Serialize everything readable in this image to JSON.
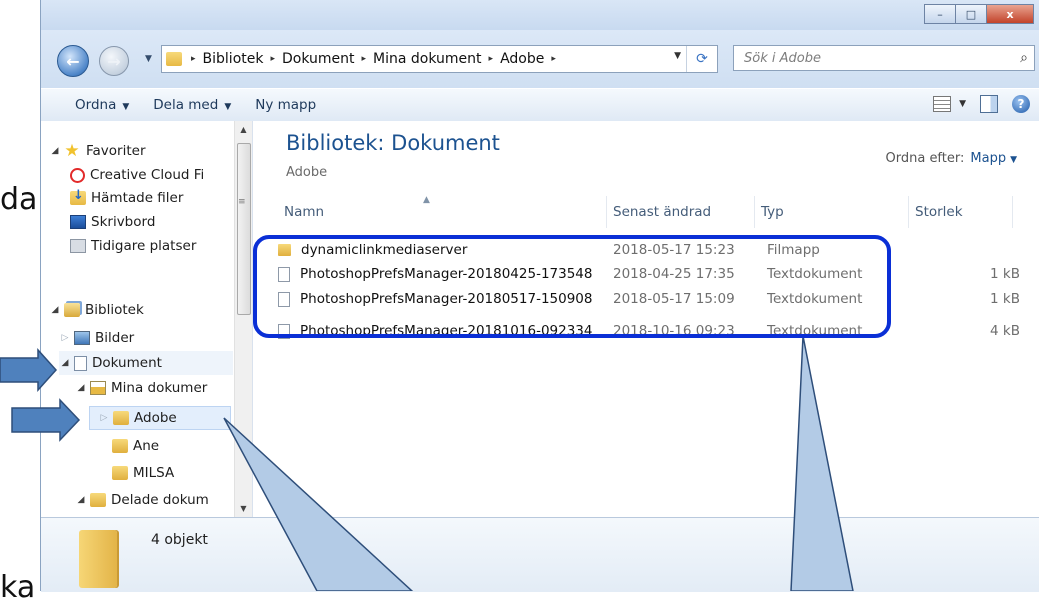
{
  "side_text": {
    "left_top": "da",
    "left_bottom": "ka"
  },
  "window": {
    "controls": {
      "minimize": "–",
      "maximize": "□",
      "close": "x"
    }
  },
  "address_bar": {
    "breadcrumbs": [
      "Bibliotek",
      "Dokument",
      "Mina dokument",
      "Adobe"
    ],
    "separator": "▸"
  },
  "search": {
    "placeholder": "Sök i Adobe"
  },
  "toolbar": {
    "organize": "Ordna",
    "share": "Dela med",
    "new_folder": "Ny mapp"
  },
  "nav_pane": {
    "items": [
      {
        "label": "Favoriter",
        "icon": "star-icon"
      },
      {
        "label": "Creative Cloud Fi",
        "icon": "creative-cloud-icon"
      },
      {
        "label": "Hämtade filer",
        "icon": "downloads-icon"
      },
      {
        "label": "Skrivbord",
        "icon": "desktop-icon"
      },
      {
        "label": "Tidigare platser",
        "icon": "recent-places-icon"
      },
      {
        "label": "Bibliotek",
        "icon": "libraries-icon"
      },
      {
        "label": "Bilder",
        "icon": "pictures-icon"
      },
      {
        "label": "Dokument",
        "icon": "documents-icon"
      },
      {
        "label": "Mina dokumer",
        "icon": "my-documents-icon"
      },
      {
        "label": "Adobe",
        "icon": "folder-icon"
      },
      {
        "label": "Ane",
        "icon": "folder-icon"
      },
      {
        "label": "MILSA",
        "icon": "folder-icon"
      },
      {
        "label": "Delade dokum",
        "icon": "folder-icon"
      }
    ]
  },
  "content": {
    "library_title": "Bibliotek: Dokument",
    "library_subtitle": "Adobe",
    "arrange_label": "Ordna efter:",
    "arrange_value": "Mapp",
    "columns": {
      "name": "Namn",
      "modified": "Senast ändrad",
      "type": "Typ",
      "size": "Storlek"
    },
    "files": [
      {
        "name": "dynamiclinkmediaserver",
        "modified": "2018-05-17 15:23",
        "type": "Filmapp",
        "size": "",
        "icon": "folder-icon"
      },
      {
        "name": "PhotoshopPrefsManager-20180425-173548",
        "modified": "2018-04-25 17:35",
        "type": "Textdokument",
        "size": "1 kB",
        "icon": "text-file-icon"
      },
      {
        "name": "PhotoshopPrefsManager-20180517-150908",
        "modified": "2018-05-17 15:09",
        "type": "Textdokument",
        "size": "1 kB",
        "icon": "text-file-icon"
      },
      {
        "name": "PhotoshopPrefsManager-20181016-092334",
        "modified": "2018-10-16 09:23",
        "type": "Textdokument",
        "size": "4 kB",
        "icon": "text-file-icon"
      }
    ]
  },
  "details": {
    "object_count": "4 objekt"
  },
  "colors": {
    "title_blue": "#1c5290",
    "annotation_blue": "#0a2fd6",
    "callout_fill": "#b3cbe6",
    "arrow_fill": "#4f81bd"
  }
}
